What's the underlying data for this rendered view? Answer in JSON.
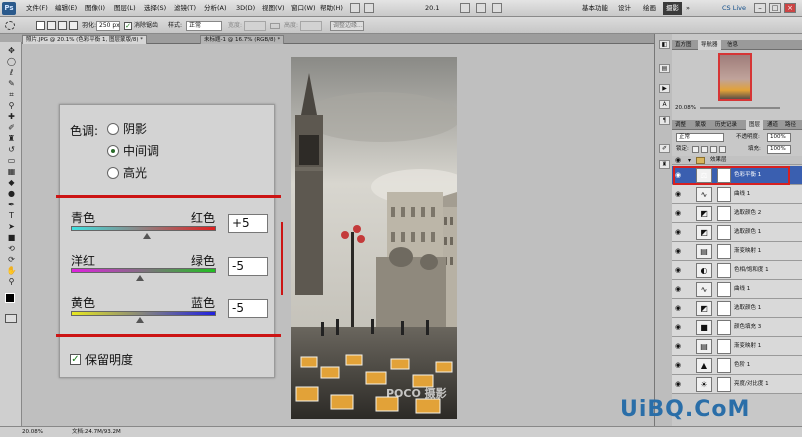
{
  "app": {
    "logo": "Ps"
  },
  "menubar": {
    "items": [
      "文件(F)",
      "编辑(E)",
      "图像(I)",
      "图层(L)",
      "选择(S)",
      "滤镜(T)",
      "分析(A)",
      "3D(D)",
      "视图(V)",
      "窗口(W)",
      "帮助(H)"
    ],
    "zoom_display": "20.1",
    "workspaces": [
      "基本功能",
      "设计",
      "绘画"
    ],
    "workspace_active": "摄影",
    "cs_live": "CS Live"
  },
  "options": {
    "feather_label": "羽化:",
    "feather_value": "250 px",
    "antialias_label": "消除锯齿",
    "style_label": "样式:",
    "style_value": "正常",
    "width_label": "宽度:",
    "height_label": "高度:",
    "refine_label": "调整边缘..."
  },
  "tabs": [
    {
      "label": "照片.JPG @ 20.1% (色彩平衡 1, 图层蒙版/8) *",
      "active": true
    },
    {
      "label": "未标题-1 @ 16.7% (RGB/8) *",
      "active": false
    }
  ],
  "color_balance": {
    "tone_label": "色调:",
    "tones": [
      {
        "label": "阴影",
        "selected": false
      },
      {
        "label": "中间调",
        "selected": true
      },
      {
        "label": "高光",
        "selected": false
      }
    ],
    "sliders": [
      {
        "left": "青色",
        "right": "红色",
        "value": "+5",
        "level": 5,
        "colors": [
          "#3fe0e0",
          "#e02020"
        ]
      },
      {
        "left": "洋红",
        "right": "绿色",
        "value": "-5",
        "level": -5,
        "colors": [
          "#e020e0",
          "#20c020"
        ]
      },
      {
        "left": "黄色",
        "right": "蓝色",
        "value": "-5",
        "level": -5,
        "colors": [
          "#e8e820",
          "#2020e0"
        ]
      }
    ],
    "preserve_label": "保留明度",
    "preserve_checked": true
  },
  "photo": {
    "watermark": "POCO 摄影"
  },
  "status": {
    "zoom": "20.08%",
    "doc": "文档:24.7M/93.2M"
  },
  "panels": {
    "top_tabs": [
      "直方图",
      "导航器",
      "信息"
    ],
    "nav_zoom": "20.08%",
    "layer_tabs": [
      "图层",
      "通道",
      "路径"
    ],
    "top2_tabs": [
      "调整",
      "蒙版",
      "历史记录"
    ],
    "blend_mode": "正常",
    "opacity_label": "不透明度:",
    "opacity_value": "100%",
    "lock_label": "锁定:",
    "fill_label": "填充:",
    "fill_value": "100%",
    "group_name": "效果层",
    "layers": [
      {
        "name": "色彩平衡 1",
        "icon": "balance-icon",
        "glyph": "⚖",
        "selected": true
      },
      {
        "name": "曲线 1",
        "icon": "curves-icon",
        "glyph": "∿",
        "selected": false
      },
      {
        "name": "选取颜色 2",
        "icon": "selective-color-icon",
        "glyph": "◩",
        "selected": false
      },
      {
        "name": "选取颜色 1",
        "icon": "selective-color-icon",
        "glyph": "◩",
        "selected": false
      },
      {
        "name": "渐变映射 1",
        "icon": "gradient-map-icon",
        "glyph": "▤",
        "selected": false
      },
      {
        "name": "色相/饱和度 1",
        "icon": "hue-saturation-icon",
        "glyph": "◐",
        "selected": false
      },
      {
        "name": "曲线 1",
        "icon": "curves-icon",
        "glyph": "∿",
        "selected": false
      },
      {
        "name": "选取颜色 1",
        "icon": "selective-color-icon",
        "glyph": "◩",
        "selected": false
      },
      {
        "name": "颜色填充 3",
        "icon": "color-fill-icon",
        "glyph": "■",
        "selected": false
      },
      {
        "name": "渐变映射 1",
        "icon": "gradient-map-icon",
        "glyph": "▤",
        "selected": false
      },
      {
        "name": "色阶 1",
        "icon": "levels-icon",
        "glyph": "▲",
        "selected": false
      },
      {
        "name": "亮度/对比度 1",
        "icon": "brightness-icon",
        "glyph": "☀",
        "selected": false
      }
    ]
  },
  "site_watermark": "UiBQ.CoM"
}
